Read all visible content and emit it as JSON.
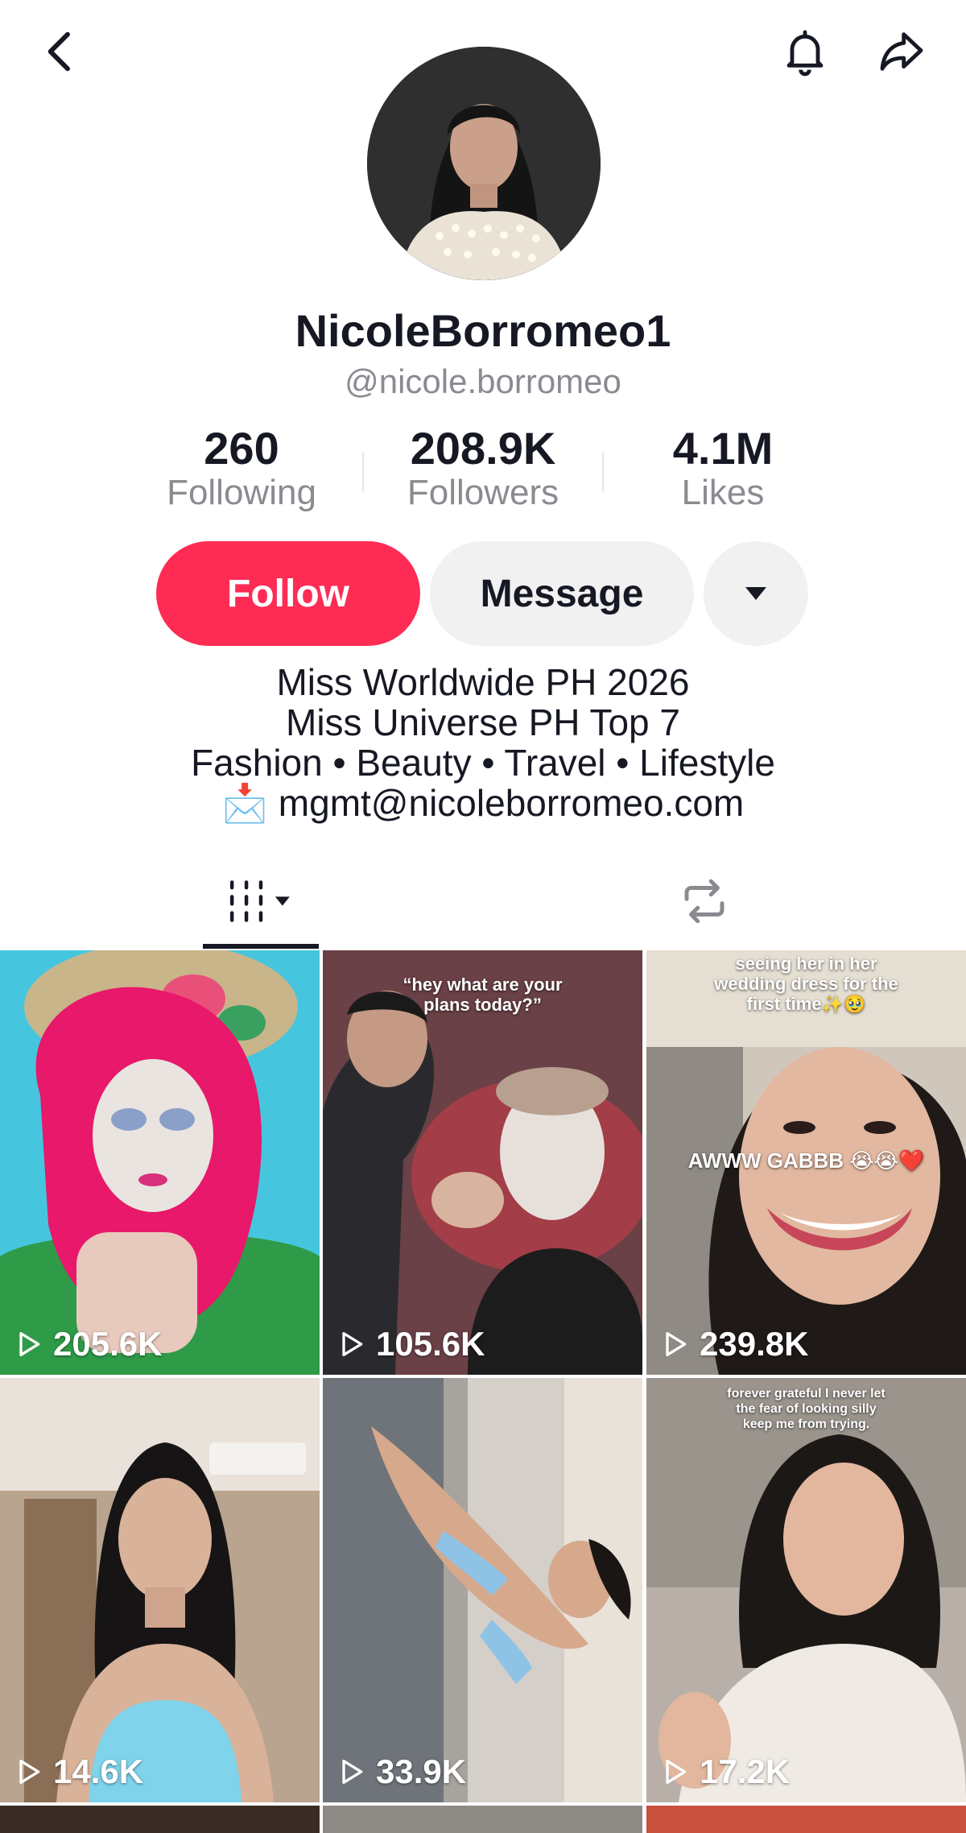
{
  "header": {
    "back_icon": "chevron-left-icon",
    "notification_icon": "bell-icon",
    "share_icon": "share-arrow-icon"
  },
  "profile": {
    "display_name": "NicoleBorromeo1",
    "handle": "@nicole.borromeo"
  },
  "stats": [
    {
      "value": "260",
      "label": "Following"
    },
    {
      "value": "208.9K",
      "label": "Followers"
    },
    {
      "value": "4.1M",
      "label": "Likes"
    }
  ],
  "actions": {
    "follow_label": "Follow",
    "message_label": "Message",
    "more_icon": "caret-down-icon"
  },
  "bio": {
    "lines": [
      "Miss Worldwide PH 2026",
      "Miss Universe PH Top 7",
      "Fashion • Beauty • Travel • Lifestyle",
      "📩 mgmt@nicoleborromeo.com"
    ]
  },
  "tabs": [
    {
      "name": "videos",
      "icon": "grid-icon",
      "active": true
    },
    {
      "name": "reposts",
      "icon": "repost-icon",
      "active": false
    }
  ],
  "videos": [
    {
      "views": "205.6K",
      "overlay_text": ""
    },
    {
      "views": "105.6K",
      "overlay_text": "“hey what are your plans today?”"
    },
    {
      "views": "239.8K",
      "overlay_text": "seeing her in her wedding dress for the first time✨🥹",
      "overlay_text_2": "AWWW GABBB 😭😭❤️"
    },
    {
      "views": "14.6K",
      "overlay_text": ""
    },
    {
      "views": "33.9K",
      "overlay_text": ""
    },
    {
      "views": "17.2K",
      "overlay_text": "forever grateful I never let the fear of looking silly keep me from trying."
    }
  ],
  "colors": {
    "follow": "#fe2c55",
    "secondary_button": "#f1f1f2",
    "muted_text": "#8a8b91"
  }
}
